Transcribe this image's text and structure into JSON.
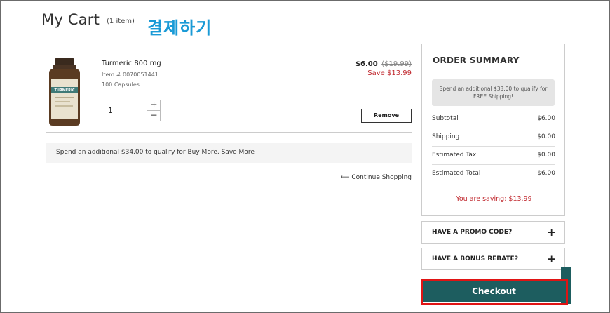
{
  "page": {
    "title": "My Cart",
    "item_count": "(1 item)",
    "annotation": "결제하기"
  },
  "product": {
    "name": "Turmeric 800 mg",
    "item_number": "Item # 0070051441",
    "capsules": "100 Capsules",
    "quantity": "1",
    "price": "$6.00",
    "original_price": "($19.99)",
    "save": "Save $13.99",
    "remove_label": "Remove",
    "bottle_label": "TURMERIC"
  },
  "buy_more_note": "Spend an additional $34.00 to qualify for Buy More, Save More",
  "continue_shopping": "⟵ Continue Shopping",
  "summary": {
    "title": "ORDER SUMMARY",
    "shipping_note": "Spend an additional $33.00 to qualify for FREE Shipping!",
    "rows": [
      {
        "label": "Subtotal",
        "value": "$6.00"
      },
      {
        "label": "Shipping",
        "value": "$0.00"
      },
      {
        "label": "Estimated Tax",
        "value": "$0.00"
      },
      {
        "label": "Estimated Total",
        "value": "$6.00"
      }
    ],
    "saving": "You are saving: $13.99"
  },
  "promo": {
    "label": "HAVE A PROMO CODE?",
    "icon": "+"
  },
  "rebate": {
    "label": "HAVE A BONUS REBATE?",
    "icon": "+"
  },
  "checkout_label": "Checkout",
  "colors": {
    "accent": "#1d5d5f",
    "sale": "#c0272d",
    "highlight": "#e01414",
    "annotation": "#1a9ad6"
  }
}
